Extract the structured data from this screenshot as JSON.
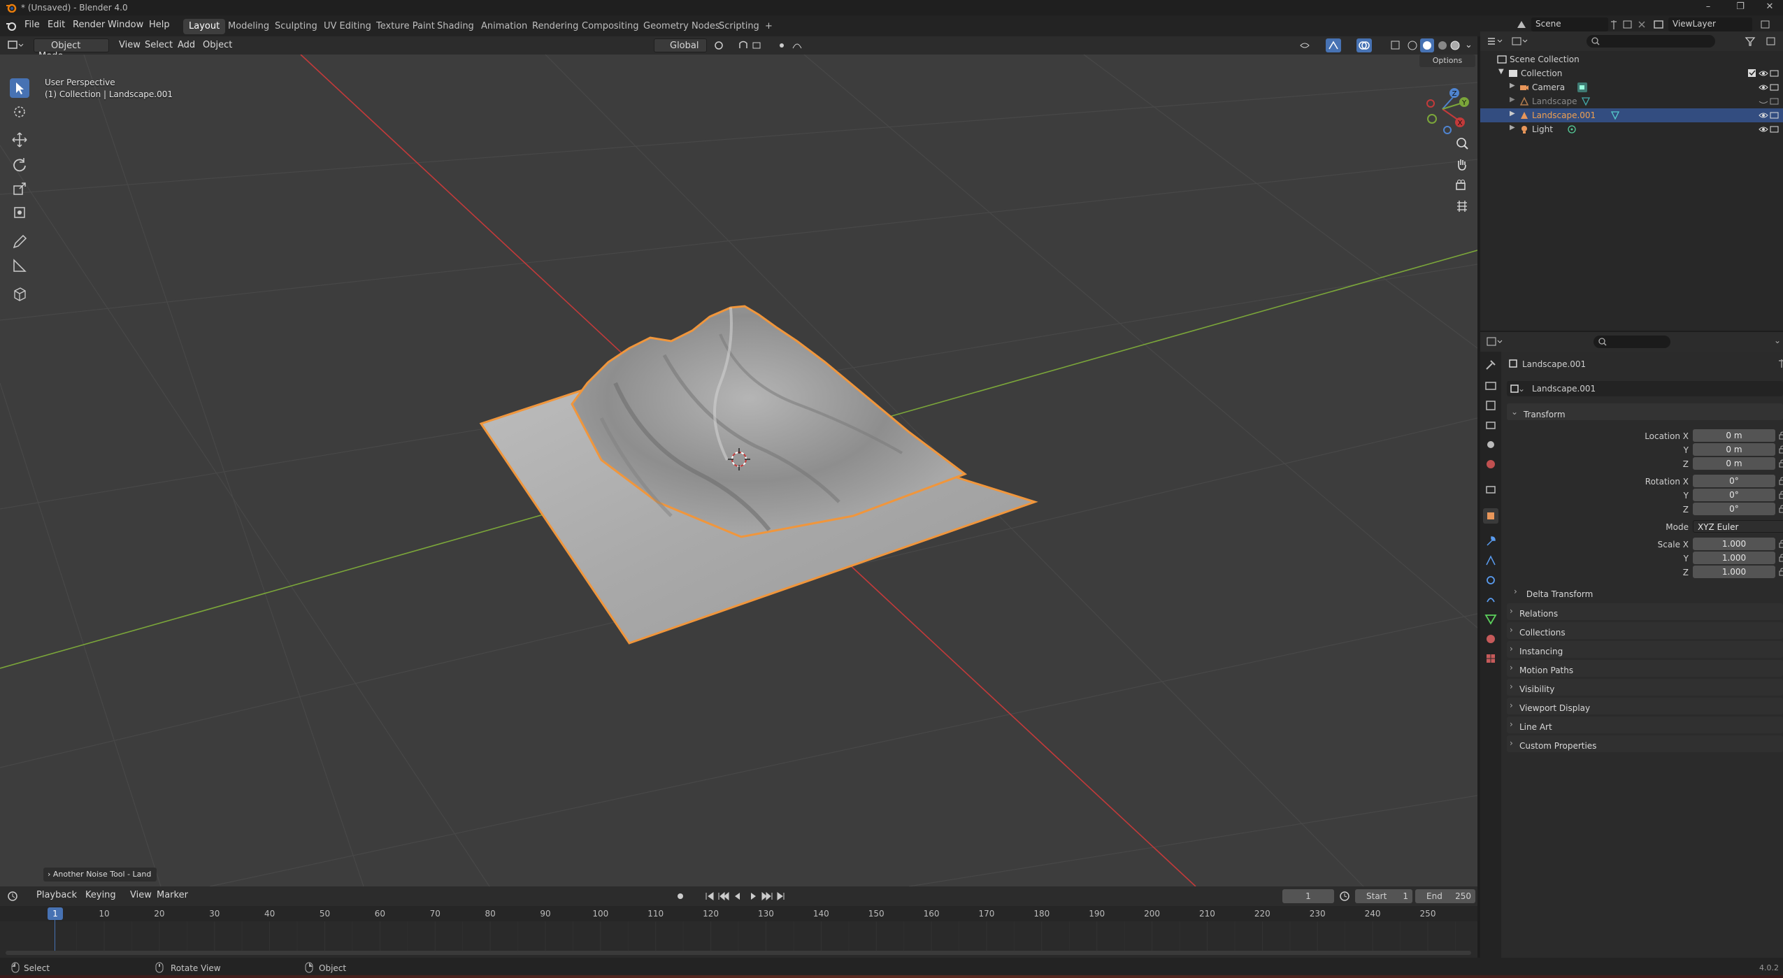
{
  "window": {
    "title": "* (Unsaved) - Blender 4.0",
    "controls": [
      "–",
      "❐",
      "✕"
    ]
  },
  "menu": [
    "File",
    "Edit",
    "Render",
    "Window",
    "Help"
  ],
  "workspaces": [
    "Layout",
    "Modeling",
    "Sculpting",
    "UV Editing",
    "Texture Paint",
    "Shading",
    "Animation",
    "Rendering",
    "Compositing",
    "Geometry Nodes",
    "Scripting",
    "+"
  ],
  "scene": {
    "name": "Scene",
    "view_layer": "ViewLayer"
  },
  "viewport_header": {
    "mode": "Object Mode",
    "menus": [
      "View",
      "Select",
      "Add",
      "Object"
    ],
    "orientation": "Global",
    "options": "Options"
  },
  "viewport": {
    "perspective": "User Perspective",
    "context": "(1) Collection | Landscape.001",
    "operator_panel": "Another Noise Tool - Land",
    "gizmo_axes": [
      "X",
      "Y",
      "Z"
    ]
  },
  "outliner": {
    "root": "Scene Collection",
    "collection": "Collection",
    "items": [
      {
        "name": "Camera",
        "icon": "camera-icon"
      },
      {
        "name": "Landscape",
        "icon": "mesh-icon"
      },
      {
        "name": "Landscape.001",
        "icon": "mesh-icon",
        "selected": true
      },
      {
        "name": "Light",
        "icon": "light-icon"
      }
    ]
  },
  "properties": {
    "object_name": "Landscape.001",
    "datablock": "Landscape.001",
    "transform_label": "Transform",
    "location": {
      "label": "Location X",
      "x": "0 m",
      "y": "0 m",
      "z": "0 m"
    },
    "rotation": {
      "label": "Rotation X",
      "x": "0°",
      "y": "0°",
      "z": "0°"
    },
    "mode_label": "Mode",
    "mode_value": "XYZ Euler",
    "scale": {
      "label": "Scale X",
      "x": "1.000",
      "y": "1.000",
      "z": "1.000"
    },
    "axis_labels": {
      "y": "Y",
      "z": "Z"
    },
    "delta": "Delta Transform",
    "sections": [
      "Relations",
      "Collections",
      "Instancing",
      "Motion Paths",
      "Visibility",
      "Viewport Display",
      "Line Art",
      "Custom Properties"
    ]
  },
  "timeline": {
    "menus": [
      "Playback",
      "Keying",
      "View",
      "Marker"
    ],
    "current_frame": "1",
    "start_label": "Start",
    "start": "1",
    "end_label": "End",
    "end": "250",
    "ticks": [
      "1",
      "10",
      "20",
      "30",
      "40",
      "50",
      "60",
      "70",
      "80",
      "90",
      "100",
      "110",
      "120",
      "130",
      "140",
      "150",
      "160",
      "170",
      "180",
      "190",
      "200",
      "210",
      "220",
      "230",
      "240",
      "250"
    ]
  },
  "statusbar": {
    "select": "Select",
    "rotate": "Rotate View",
    "object": "Object",
    "version": "4.0.2"
  },
  "colors": {
    "accent": "#4772b3",
    "selection_outline": "#f0963c",
    "x_axis": "#c33a3a",
    "y_axis": "#7ba63a",
    "viewport_bg": "#3d3d3d"
  }
}
